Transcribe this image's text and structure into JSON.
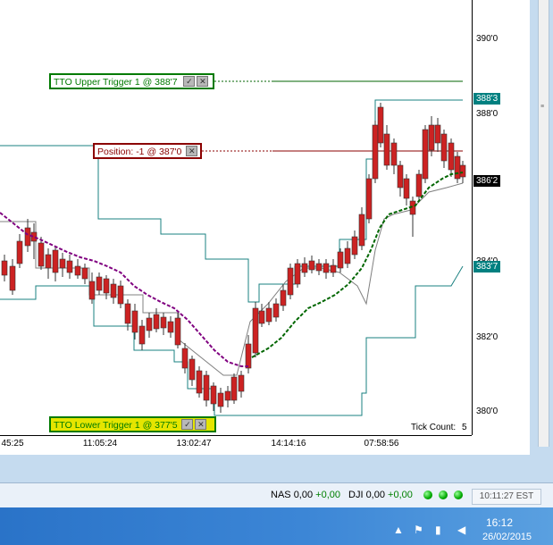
{
  "chart": {
    "price_axis_labels": [
      "390'0",
      "388'0",
      "384'0",
      "382'0",
      "380'0"
    ],
    "time_axis_labels": [
      "45:25",
      "11:05:24",
      "13:02:47",
      "14:14:16",
      "07:58:56"
    ],
    "tick_count_label": "Tick Count:",
    "tick_count_value": "5",
    "price_tags": [
      {
        "label": "388'3",
        "color": "#008080"
      },
      {
        "label": "386'2",
        "color": "#000000"
      },
      {
        "label": "383'7",
        "color": "#008080"
      }
    ],
    "upper_trigger": {
      "label": "TTO Upper Trigger 1 @ 388'7",
      "border": "#007a00",
      "bg": "#ffffff",
      "text": "#007a00"
    },
    "position": {
      "label": "Position: -1 @ 387'0",
      "border": "#8b0000",
      "bg": "#ffffff",
      "text": "#8b0000"
    },
    "lower_trigger": {
      "label": "TTO Lower Trigger 1 @ 377'5",
      "border": "#007a00",
      "bg": "#e5e500",
      "text": "#007a00"
    },
    "colors": {
      "up_candle": "#33cccc",
      "down_candle": "#cc2222",
      "channel": "#1a8080",
      "ma_purple": "#800080",
      "ma_green": "#006600",
      "gray_line": "#808080"
    }
  },
  "status_bar": {
    "tickers": [
      {
        "name": "NAS",
        "value": "0,00",
        "change": "+0,00"
      },
      {
        "name": "DJI",
        "value": "0,00",
        "change": "+0,00"
      }
    ],
    "clock": "10:11:27 EST"
  },
  "taskbar": {
    "time": "16:12",
    "date": "26/02/2015"
  }
}
